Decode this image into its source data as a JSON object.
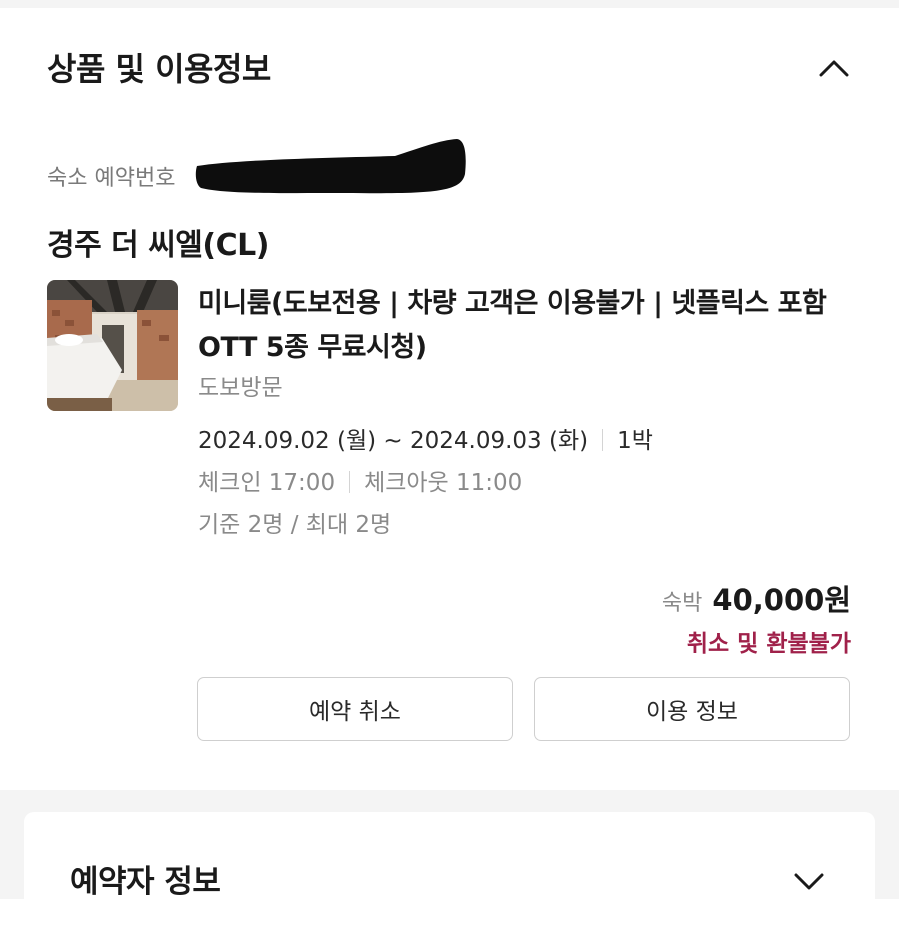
{
  "product_section": {
    "title": "상품 및 이용정보",
    "toggle_icon": "chevron-up-icon"
  },
  "reservation": {
    "number_label": "숙소 예약번호",
    "hotel_name": "경주 더 씨엘(CL)",
    "room_name": "미니룸(도보전용 | 차량 고객은 이용불가 | 넷플릭스 포함 OTT 5종 무료시청)",
    "visit_type": "도보방문",
    "date_range": "2024.09.02 (월) ~ 2024.09.03 (화)",
    "nights": "1박",
    "checkin": "체크인 17:00",
    "checkout": "체크아웃 11:00",
    "capacity": "기준 2명 / 최대 2명",
    "price_label": "숙박",
    "price": "40,000원",
    "refund_policy": "취소 및 환불불가"
  },
  "actions": {
    "cancel_label": "예약 취소",
    "info_label": "이용 정보"
  },
  "booker_section": {
    "title": "예약자 정보",
    "toggle_icon": "chevron-down-icon"
  },
  "colors": {
    "refund_text": "#a0214a",
    "background_band": "#f4f4f4"
  }
}
